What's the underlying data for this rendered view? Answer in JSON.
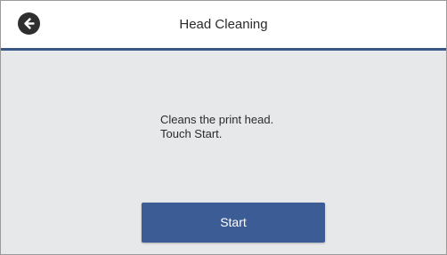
{
  "header": {
    "title": "Head Cleaning",
    "back_icon": "arrow-left-circle-icon"
  },
  "main": {
    "message_lines": [
      "Cleans the print head.",
      "Touch Start."
    ],
    "start_label": "Start"
  },
  "colors": {
    "header_divider": "#3a5887",
    "background": "#e7e8ea",
    "primary_button": "#3c5c95"
  }
}
